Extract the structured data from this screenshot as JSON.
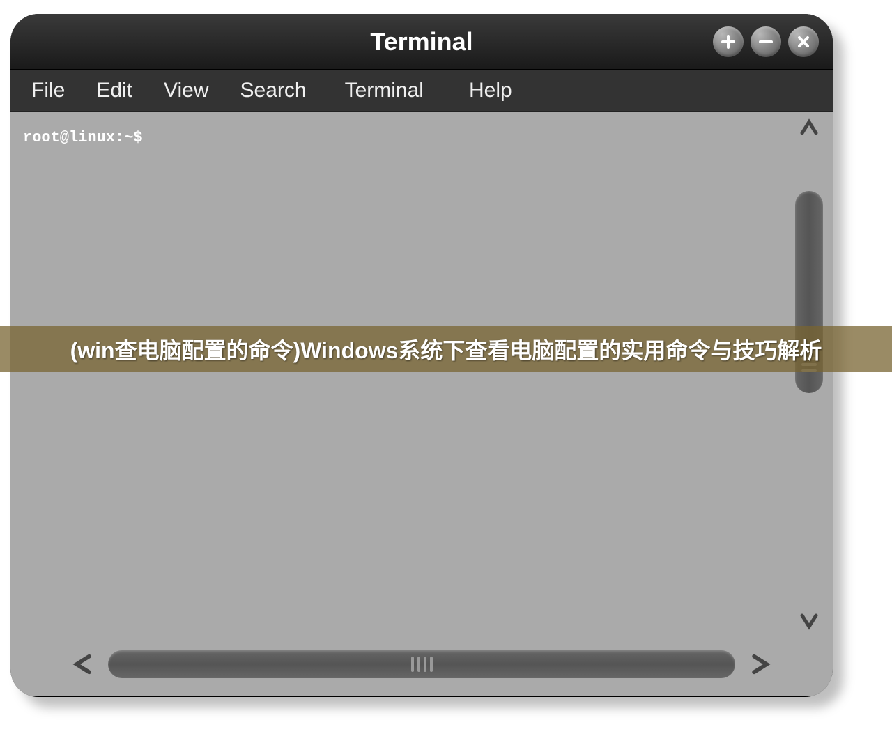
{
  "window": {
    "title": "Terminal"
  },
  "menubar": {
    "items": [
      "File",
      "Edit",
      "View",
      "Search",
      "Terminal",
      "Help"
    ]
  },
  "terminal": {
    "prompt": "root@linux:~$"
  },
  "overlay": {
    "text": "(win查电脑配置的命令)Windows系统下查看电脑配置的实用命令与技巧解析"
  }
}
